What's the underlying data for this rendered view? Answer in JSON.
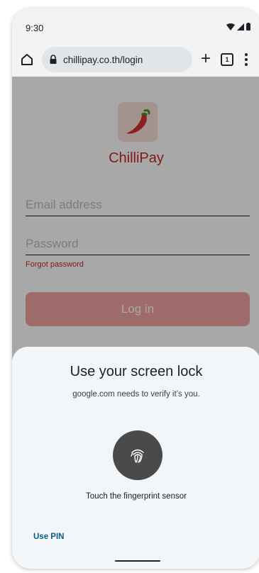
{
  "status_bar": {
    "time": "9:30"
  },
  "browser": {
    "url": "chillipay.co.th/login",
    "tab_count": "1",
    "new_tab_symbol": "+"
  },
  "login_page": {
    "brand_name": "ChilliPay",
    "email_placeholder": "Email address",
    "password_placeholder": "Password",
    "forgot_password": "Forgot password",
    "login_label": "Log in",
    "brand_color": "#c62828",
    "login_button_color": "#f1a3a3",
    "logo_icon": "chilli-pepper-icon"
  },
  "screen_lock_sheet": {
    "title": "Use your screen lock",
    "subtitle": "google.com needs to verify it’s you.",
    "fingerprint_icon": "fingerprint-icon",
    "sensor_prompt": "Touch the fingerprint sensor",
    "use_pin_label": "Use PIN",
    "link_color": "#0b5e8a"
  },
  "icons": {
    "status": [
      "wifi-icon",
      "signal-icon",
      "battery-icon"
    ],
    "toolbar": [
      "home-icon",
      "lock-icon",
      "plus-icon",
      "tab-switcher-icon",
      "more-menu-icon"
    ]
  }
}
